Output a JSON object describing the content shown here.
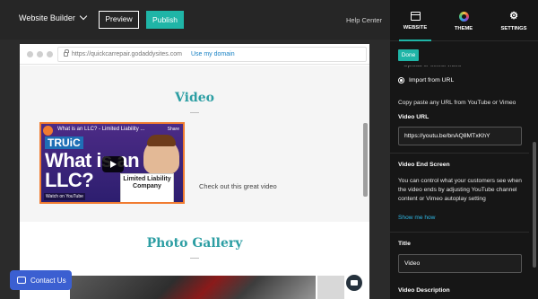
{
  "topbar": {
    "site_menu_label": "Website Builder",
    "preview_label": "Preview",
    "publish_label": "Publish",
    "help_label": "Help Center"
  },
  "browser": {
    "url": "https://quickcarrepair.godaddysites.com",
    "use_domain_label": "Use my domain"
  },
  "page": {
    "video_section": {
      "title": "Video",
      "caption": "Check out this great video",
      "thumbnail": {
        "title": "What is an LLC? - Limited Liability ...",
        "share_label": "Share",
        "brand": "TRUiC",
        "headline": "What is an LLC?",
        "card_text": "Limited Liability Company",
        "watch_label": "Watch on YouTube"
      }
    },
    "gallery_section": {
      "title": "Photo Gallery"
    }
  },
  "contact_button": {
    "label": "Contact Us"
  },
  "panel": {
    "tabs": [
      {
        "label": "WEBSITE",
        "icon": "browser-window-icon",
        "active": true
      },
      {
        "label": "THEME",
        "icon": "color-wheel-icon",
        "active": false
      },
      {
        "label": "SETTINGS",
        "icon": "gear-icon",
        "active": false
      }
    ],
    "done_label": "Done",
    "partial_option": "Upload or select video",
    "import_option": "Import from URL",
    "import_hint": "Copy paste any URL from YouTube or Vimeo",
    "video_url_label": "Video URL",
    "video_url_value": "https://youtu.be/bnAQ8MTxKhY",
    "end_screen_label": "Video End Screen",
    "end_screen_text": "You can control what your customers see when the video ends by adjusting YouTube channel content or Vimeo autoplay setting",
    "show_me_how_label": "Show me how",
    "title_label": "Title",
    "title_value": "Video",
    "description_label": "Video Description"
  },
  "colors": {
    "accent": "#1fb5a7",
    "heading": "#2c9ea3",
    "contact": "#3b5fd1",
    "link": "#2fb9e6"
  }
}
